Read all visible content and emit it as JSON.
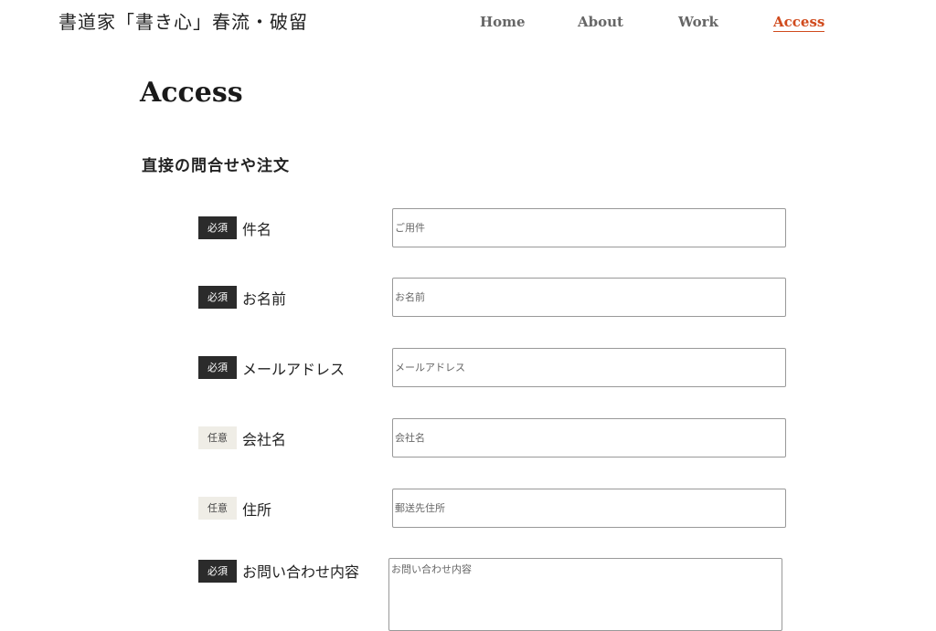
{
  "header": {
    "site_title": "書道家「書き心」春流・破留",
    "nav": [
      {
        "label": "Home",
        "active": false
      },
      {
        "label": "About",
        "active": false
      },
      {
        "label": "Work",
        "active": false
      },
      {
        "label": "Access",
        "active": true
      }
    ],
    "active_color": "#d04a1c"
  },
  "main": {
    "page_title": "Access",
    "section_heading": "直接の問合せや注文",
    "form": {
      "fields": [
        {
          "badge": "必須",
          "required": true,
          "label": "件名",
          "placeholder": "ご用件",
          "value": ""
        },
        {
          "badge": "必須",
          "required": true,
          "label": "お名前",
          "placeholder": "お名前",
          "value": ""
        },
        {
          "badge": "必須",
          "required": true,
          "label": "メールアドレス",
          "placeholder": "メールアドレス",
          "value": ""
        },
        {
          "badge": "任意",
          "required": false,
          "label": "会社名",
          "placeholder": "会社名",
          "value": ""
        },
        {
          "badge": "任意",
          "required": false,
          "label": "住所",
          "placeholder": "郵送先住所",
          "value": ""
        },
        {
          "badge": "必須",
          "required": true,
          "label": "お問い合わせ内容",
          "placeholder": "お問い合わせ内容",
          "value": ""
        }
      ]
    }
  },
  "colors": {
    "required_badge_bg": "#2b2b2b",
    "optional_badge_bg": "#efede6"
  }
}
